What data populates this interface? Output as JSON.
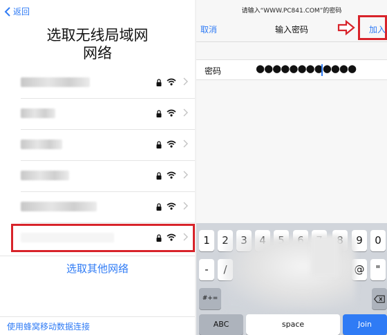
{
  "left": {
    "back_label": "返回",
    "title_line1": "选取无线局域网",
    "title_line2": "网络",
    "networks": [
      {
        "name": "",
        "secured": true
      },
      {
        "name": "",
        "secured": true
      },
      {
        "name": "",
        "secured": true
      },
      {
        "name": "",
        "secured": true
      },
      {
        "name": "",
        "secured": true
      },
      {
        "name": "",
        "secured": true,
        "selected": true
      }
    ],
    "other_network_label": "选取其他网络",
    "cellular_label": "使用蜂窝移动数据连接"
  },
  "right": {
    "prompt": "请输入“WWW.PC841.COM”的密码",
    "cancel_label": "取消",
    "header_title": "输入密码",
    "join_label": "加入",
    "password_label": "密码",
    "password_value": "●●●●●●●●●●●●"
  },
  "keyboard": {
    "number_keys": [
      "1",
      "2",
      "3",
      "4",
      "5",
      "6",
      "7",
      "8",
      "9",
      "0"
    ],
    "symbol_row": [
      "-",
      "/",
      "@",
      "\""
    ],
    "symbol_toggle": "#+=",
    "abc_label": "ABC",
    "space_label": "space",
    "join_key_label": "Join"
  },
  "colors": {
    "accent": "#2f7bf5",
    "highlight": "#d8232a",
    "keyboard_bg": "#d1d5db"
  }
}
